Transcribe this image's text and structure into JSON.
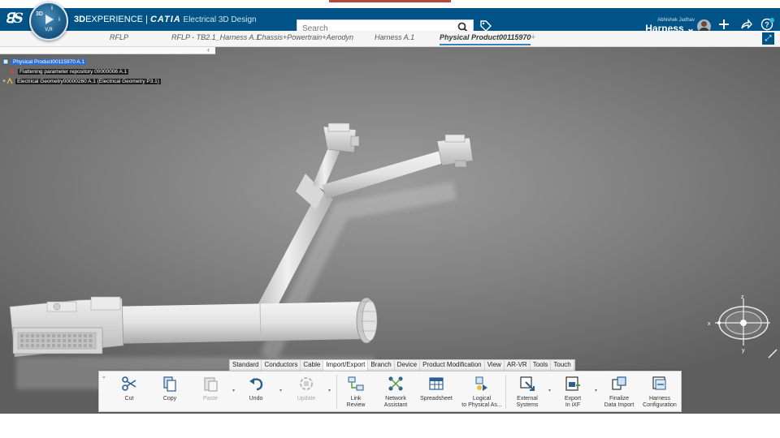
{
  "header": {
    "ds_logo": "ꓭS",
    "compass": {
      "top": "3D",
      "left": "◁",
      "right": "▷",
      "bottom": "V,R"
    },
    "brand_3dx": "3D",
    "brand_experience": "EXPERIENCE | ",
    "brand_catia": "CATIA",
    "brand_app": " Electrical 3D Design",
    "search_placeholder": "Search",
    "user_name": "Abhishek Jadhav",
    "role": "Harness ⌄",
    "icons": [
      "search-icon",
      "tag-icon",
      "avatar",
      "add-icon",
      "share-icon",
      "help-icon"
    ]
  },
  "tabs": [
    {
      "label": "RFLP"
    },
    {
      "label": "RFLP - TB2.1_Harness A.1"
    },
    {
      "label": "Chassis+Powertrain+Aerodyn"
    },
    {
      "label": "Harness A.1"
    },
    {
      "label": "Physical Product00115970"
    }
  ],
  "tab_plus": "+",
  "tree": {
    "root": "Physical Product00115970 A.1",
    "children": [
      "Flattening parameter repository 00000006 A.1",
      "Electrical Geometry00000260 A.1 (Electrical Geometry P3.1)"
    ]
  },
  "compass3d": {
    "z": "z",
    "x": "x",
    "y": "y"
  },
  "ribbon": {
    "tabs": [
      "Standard",
      "Conductors",
      "Cable",
      "Import/Export",
      "Branch",
      "Device",
      "Product Modification",
      "View",
      "AR-VR",
      "Tools",
      "Touch"
    ],
    "active_tab": "Import/Export",
    "commands": [
      {
        "label": "Cut",
        "icon": "scissors-icon",
        "enabled": true
      },
      {
        "label": "Copy",
        "icon": "copy-icon",
        "enabled": true
      },
      {
        "label": "Paste",
        "icon": "paste-icon",
        "enabled": false
      },
      {
        "label": "Undo",
        "icon": "undo-icon",
        "enabled": true
      },
      {
        "label": "Update",
        "icon": "update-icon",
        "enabled": false
      },
      {
        "label": "Link\nReview",
        "icon": "link-review-icon",
        "enabled": true
      },
      {
        "label": "Network\nAssistant",
        "icon": "network-assistant-icon",
        "enabled": true
      },
      {
        "label": "Spreadsheet",
        "icon": "spreadsheet-icon",
        "enabled": true
      },
      {
        "label": "Logical\nto Physical As...",
        "icon": "logical-to-physical-icon",
        "enabled": true
      },
      {
        "label": "External\nSystems",
        "icon": "external-systems-icon",
        "enabled": true
      },
      {
        "label": "Export\nIn iXF",
        "icon": "export-ixf-icon",
        "enabled": true
      },
      {
        "label": "Finalize\nData Import",
        "icon": "finalize-import-icon",
        "enabled": true
      },
      {
        "label": "Harness\nConfiguration",
        "icon": "harness-config-icon",
        "enabled": true
      }
    ]
  },
  "colors": {
    "header": "#005386",
    "accent": "#3d7eb9",
    "selection": "#2c6fd6"
  }
}
